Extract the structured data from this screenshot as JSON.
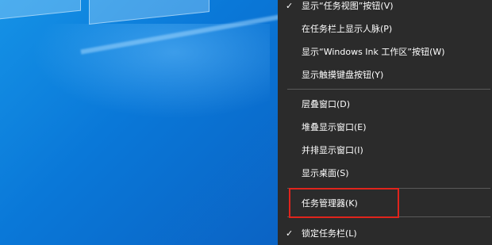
{
  "context_menu": {
    "items": [
      {
        "label": "显示“任务视图”按钮(V)",
        "checked": true
      },
      {
        "label": "在任务栏上显示人脉(P)",
        "checked": false
      },
      {
        "label": "显示“Windows Ink 工作区”按钮(W)",
        "checked": false
      },
      {
        "label": "显示触摸键盘按钮(Y)",
        "checked": false
      },
      {
        "label": "层叠窗口(D)",
        "checked": false
      },
      {
        "label": "堆叠显示窗口(E)",
        "checked": false
      },
      {
        "label": "并排显示窗口(I)",
        "checked": false
      },
      {
        "label": "显示桌面(S)",
        "checked": false
      },
      {
        "label": "任务管理器(K)",
        "checked": false
      },
      {
        "label": "锁定任务栏(L)",
        "checked": true
      }
    ],
    "check_mark": "✓"
  },
  "colors": {
    "menu_background": "#2b2b2b",
    "highlight_border": "#e0241c",
    "desktop_blue": "#0a78d8"
  }
}
